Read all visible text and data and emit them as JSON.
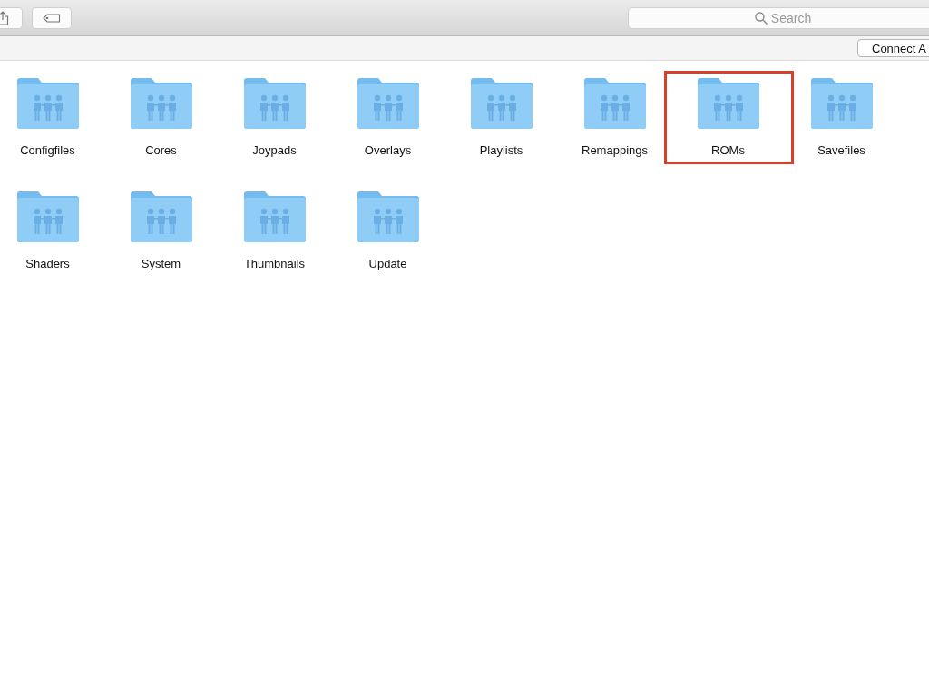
{
  "search": {
    "placeholder": "Search"
  },
  "connect_button": "Connect A",
  "folders": [
    {
      "label": "Configfiles",
      "highlighted": false
    },
    {
      "label": "Cores",
      "highlighted": false
    },
    {
      "label": "Joypads",
      "highlighted": false
    },
    {
      "label": "Overlays",
      "highlighted": false
    },
    {
      "label": "Playlists",
      "highlighted": false
    },
    {
      "label": "Remappings",
      "highlighted": false
    },
    {
      "label": "ROMs",
      "highlighted": true
    },
    {
      "label": "Savefiles",
      "highlighted": false
    },
    {
      "label": "Shaders",
      "highlighted": false
    },
    {
      "label": "System",
      "highlighted": false
    },
    {
      "label": "Thumbnails",
      "highlighted": false
    },
    {
      "label": "Update",
      "highlighted": false
    }
  ]
}
